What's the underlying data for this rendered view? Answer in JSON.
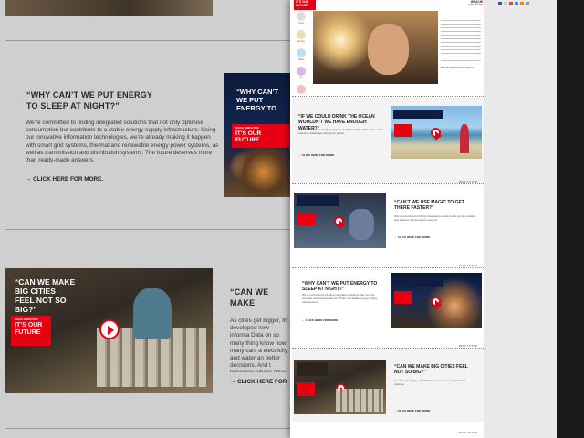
{
  "left_page": {
    "section1": {
      "headline": "“WHY CAN’T WE PUT ENERGY\nTO SLEEP AT NIGHT?”",
      "body": "We’re committed to finding integrated solutions that not only optimise consumption but contribute to a stable energy supply infrastructure. Using our innovative information technologies, we’re already making it happen with smart grid systems, thermal and renewable energy power systems, as well as transmission and distribution systems. The future deserves more than ready-made answers.",
      "cta": "→ CLICK HERE FOR MORE.",
      "thumb_headline": "“WHY CAN’T WE PUT ENERGY TO SLEEP AT NIGHT?”",
      "thumb_tag_small": "SOCIAL INNOVATION",
      "thumb_tag_big": "IT’S OUR FUTURE"
    },
    "section2": {
      "headline": "“CAN WE MAKE\nFEEL NOT SO",
      "body": "As cities get bigger, th developed new informa Data on so many thing know how many cars a electricity and water an better decisions. And t tomorrow where cities",
      "cta": "→ CLICK HERE FOR",
      "thumb_headline": "“CAN WE MAKE BIG CITIES FEEL NOT SO BIG?”",
      "thumb_tag_small": "SOCIAL INNOVATION",
      "thumb_tag_big": "IT’S OUR FUTURE"
    }
  },
  "overlay_page": {
    "logo": "IT’S OUR FUTURE",
    "brand": "HITACHI",
    "brand_tagline": "Inspire the Next",
    "hero_caption": "Hitachi Social Innovation",
    "sidebar_items": [
      "Home",
      "Energy",
      "Water",
      "City",
      "Health"
    ],
    "sections": [
      {
        "headline": "“IF WE COULD DRINK THE OCEAN WOULDN’T WE HAVE ENOUGH WATER?”",
        "body": "We’re committed to finding integrated solutions that address the water resource challenges facing our planet.",
        "cta": "→ CLICK HERE FOR MORE.",
        "back": "BACK TO TOP"
      },
      {
        "headline": "“CAN’T WE USE MAGIC TO GET THERE FASTER?”",
        "body": "We’re committed to finding integrated solutions that provide reliable and efficient transportation systems.",
        "cta": "→ CLICK HERE FOR MORE.",
        "back": "BACK TO TOP"
      },
      {
        "headline": "“WHY CAN’T WE PUT ENERGY TO SLEEP AT NIGHT?”",
        "body": "We’re committed to finding integrated solutions that not only optimise consumption but contribute to a stable energy supply infrastructure.",
        "cta": "→ CLICK HERE FOR MORE.",
        "back": "BACK TO TOP"
      },
      {
        "headline": "“CAN WE MAKE BIG CITIES FEEL NOT SO BIG?”",
        "body": "As cities get bigger, Hitachi has developed new information systems.",
        "cta": "→ CLICK HERE FOR MORE.",
        "back": "BACK TO TOP"
      }
    ]
  },
  "colors": {
    "accent_red": "#e60012",
    "navy": "#0f1d40"
  }
}
